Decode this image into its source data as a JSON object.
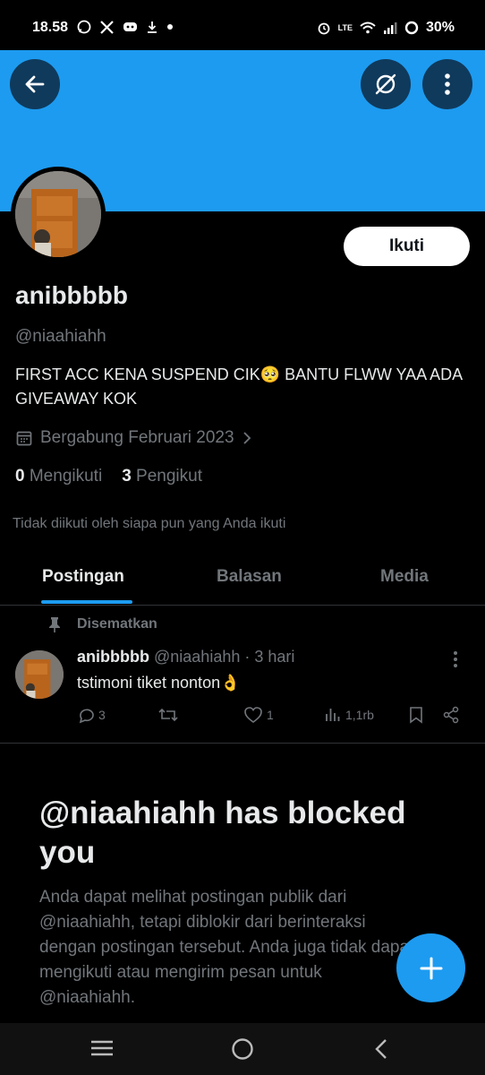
{
  "status_bar": {
    "time": "18.58",
    "network_label": "LTE",
    "battery": "30%"
  },
  "colors": {
    "accent": "#1d9bf0",
    "background": "#000000",
    "text_primary": "#e7e9ea",
    "text_secondary": "#71767b"
  },
  "profile": {
    "display_name": "anibbbbb",
    "handle": "@niaahiahh",
    "bio": "FIRST ACC KENA SUSPEND CIK🥺 BANTU FLWW YAA ADA GIVEAWAY KOK",
    "joined": "Bergabung Februari 2023",
    "following_count": "0",
    "following_label": "Mengikuti",
    "followers_count": "3",
    "followers_label": "Pengikut",
    "not_followed_note": "Tidak diikuti oleh siapa pun yang Anda ikuti",
    "follow_button": "Ikuti"
  },
  "tabs": [
    {
      "label": "Postingan",
      "active": true
    },
    {
      "label": "Balasan",
      "active": false
    },
    {
      "label": "Media",
      "active": false
    }
  ],
  "pinned_post": {
    "pinned_label": "Disematkan",
    "author_name": "anibbbbb",
    "author_handle": "@niaahiahh",
    "time": "· 3 hari",
    "text": "tstimoni tiket nonton👌",
    "replies": "3",
    "retweets": "",
    "likes": "1",
    "views": "1,1rb"
  },
  "blocked_notice": {
    "title": "@niaahiahh has blocked you",
    "body": "Anda dapat melihat postingan publik dari @niaahiahh, tetapi diblokir dari berinteraksi dengan postingan tersebut. Anda juga tidak dapat mengikuti atau mengirim pesan untuk @niaahiahh."
  },
  "icons": {
    "back": "arrow-left-icon",
    "grok": "grok-icon",
    "more": "more-vertical-icon",
    "calendar": "calendar-icon",
    "pin": "pin-icon",
    "reply": "reply-icon",
    "retweet": "retweet-icon",
    "like": "heart-icon",
    "views": "views-icon",
    "bookmark": "bookmark-icon",
    "share": "share-icon",
    "compose": "plus-icon"
  }
}
